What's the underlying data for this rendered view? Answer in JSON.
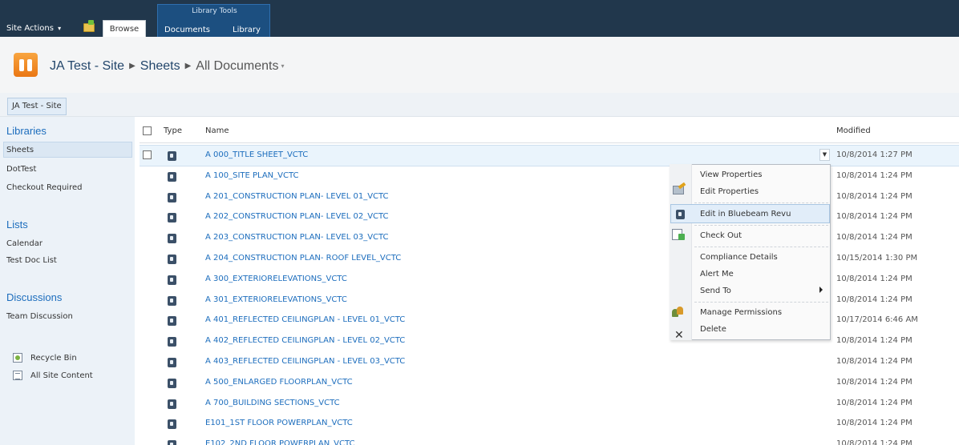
{
  "ribbon": {
    "site_actions": "Site Actions",
    "browse_tab": "Browse",
    "context_group_title": "Library Tools",
    "context_tabs": [
      "Documents",
      "Library"
    ]
  },
  "title": {
    "site": "JA Test - Site",
    "library": "Sheets",
    "view": "All Documents"
  },
  "topnav": {
    "item": "JA Test - Site"
  },
  "quicklaunch": {
    "libraries_heading": "Libraries",
    "libraries": [
      "Sheets",
      "DotTest",
      "Checkout Required"
    ],
    "lists_heading": "Lists",
    "lists": [
      "Calendar",
      "Test Doc List"
    ],
    "discussions_heading": "Discussions",
    "discussions": [
      "Team Discussion"
    ],
    "recycle_bin": "Recycle Bin",
    "all_site_content": "All Site Content"
  },
  "list": {
    "columns": {
      "type": "Type",
      "name": "Name",
      "modified": "Modified"
    },
    "rows": [
      {
        "name": "A 000_TITLE SHEET_VCTC",
        "modified": "10/8/2014 1:27 PM"
      },
      {
        "name": "A 100_SITE PLAN_VCTC",
        "modified": "10/8/2014 1:24 PM"
      },
      {
        "name": "A 201_CONSTRUCTION PLAN- LEVEL 01_VCTC",
        "modified": "10/8/2014 1:24 PM"
      },
      {
        "name": "A 202_CONSTRUCTION PLAN- LEVEL 02_VCTC",
        "modified": "10/8/2014 1:24 PM"
      },
      {
        "name": "A 203_CONSTRUCTION PLAN- LEVEL 03_VCTC",
        "modified": "10/8/2014 1:24 PM"
      },
      {
        "name": "A 204_CONSTRUCTION PLAN- ROOF LEVEL_VCTC",
        "modified": "10/15/2014 1:30 PM"
      },
      {
        "name": "A 300_EXTERIORELEVATIONS_VCTC",
        "modified": "10/8/2014 1:24 PM"
      },
      {
        "name": "A 301_EXTERIORELEVATIONS_VCTC",
        "modified": "10/8/2014 1:24 PM"
      },
      {
        "name": "A 401_REFLECTED CEILINGPLAN - LEVEL 01_VCTC",
        "modified": "10/17/2014 6:46 AM"
      },
      {
        "name": "A 402_REFLECTED CEILINGPLAN - LEVEL 02_VCTC",
        "modified": "10/8/2014 1:24 PM"
      },
      {
        "name": "A 403_REFLECTED CEILINGPLAN - LEVEL 03_VCTC",
        "modified": "10/8/2014 1:24 PM"
      },
      {
        "name": "A 500_ENLARGED FLOORPLAN_VCTC",
        "modified": "10/8/2014 1:24 PM"
      },
      {
        "name": "A 700_BUILDING SECTIONS_VCTC",
        "modified": "10/8/2014 1:24 PM"
      },
      {
        "name": "E101_1ST FLOOR POWERPLAN_VCTC",
        "modified": "10/8/2014 1:24 PM"
      },
      {
        "name": "E102_2ND FLOOR POWERPLAN_VCTC",
        "modified": "10/8/2014 1:24 PM"
      }
    ]
  },
  "context_menu": {
    "view_properties": "View Properties",
    "edit_properties": "Edit Properties",
    "edit_in_bluebeam": "Edit in Bluebeam Revu",
    "check_out": "Check Out",
    "compliance_details": "Compliance Details",
    "alert_me": "Alert Me",
    "send_to": "Send To",
    "manage_permissions": "Manage Permissions",
    "delete": "Delete"
  }
}
